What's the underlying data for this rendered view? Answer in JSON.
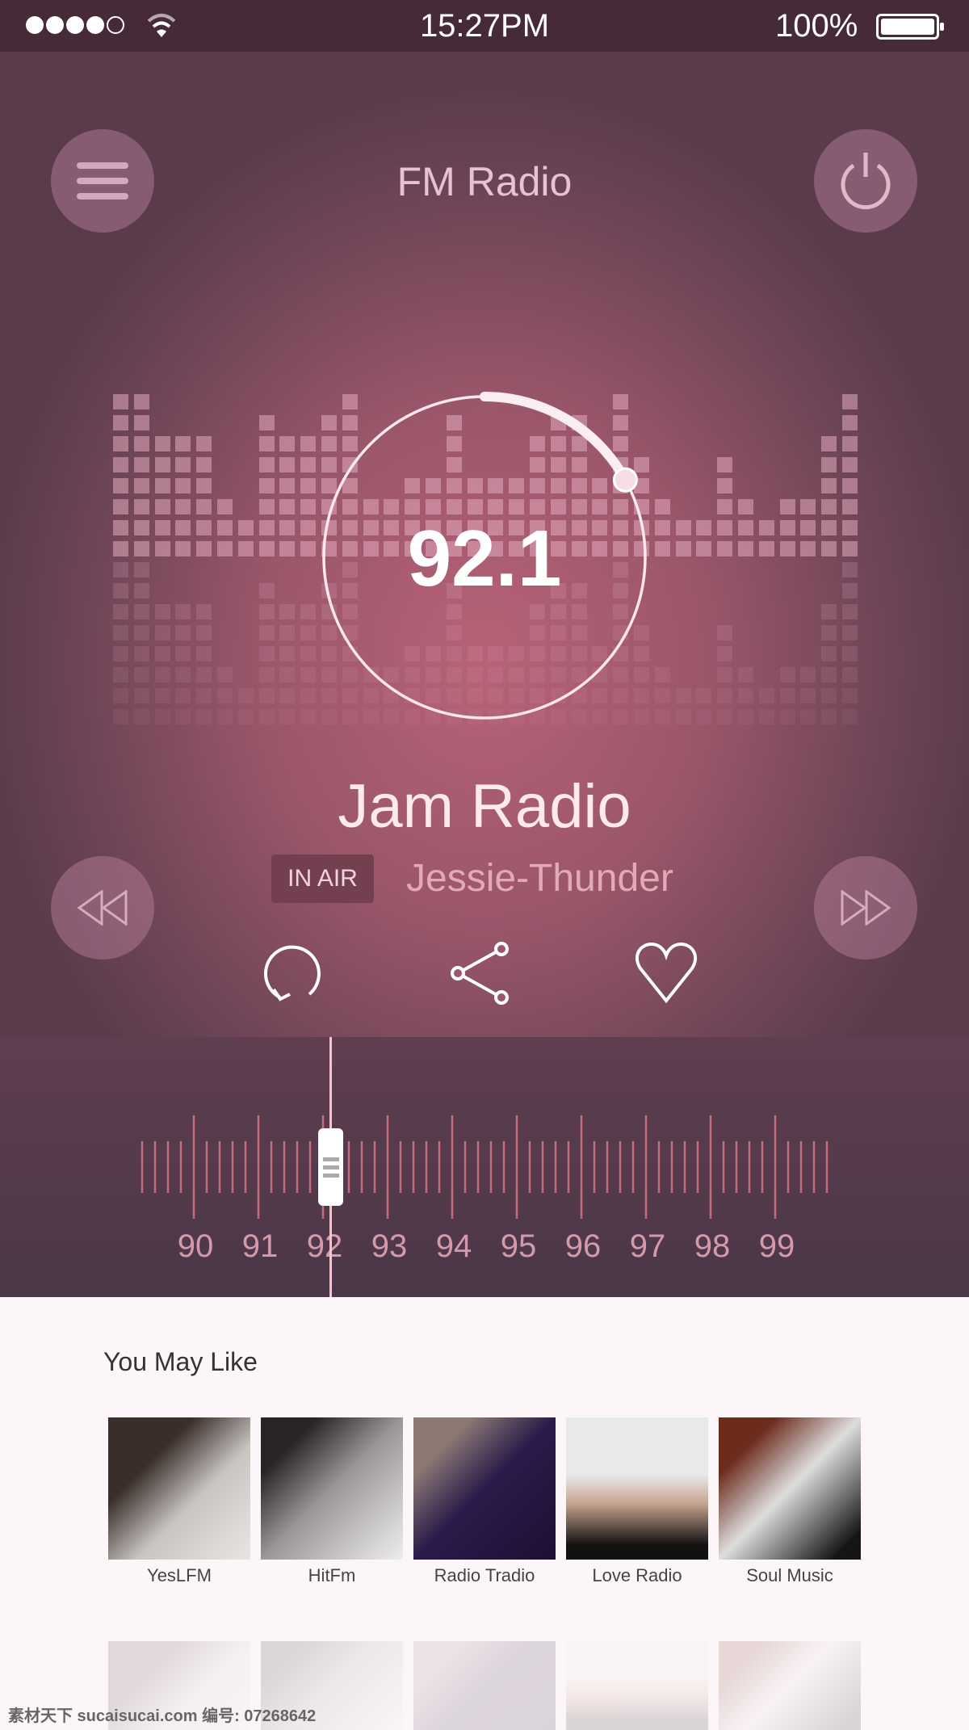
{
  "status_bar": {
    "signal_filled": 4,
    "signal_total": 5,
    "time": "15:27PM",
    "battery": "100%",
    "icons": [
      "signal-dots-icon",
      "wifi-icon",
      "battery-icon"
    ]
  },
  "header": {
    "title": "FM Radio",
    "menu_icon": "menu-icon",
    "power_icon": "power-icon"
  },
  "player": {
    "frequency": "92.1",
    "station": "Jam Radio",
    "badge": "IN AIR",
    "track": "Jessie-Thunder",
    "dial_progress": 0.17,
    "controls": [
      "rewind-icon",
      "fast-forward-icon",
      "repeat-icon",
      "share-icon",
      "heart-icon"
    ]
  },
  "tuner": {
    "labels": [
      "90",
      "91",
      "92",
      "93",
      "94",
      "95",
      "96",
      "97",
      "98",
      "99"
    ],
    "value": 92.1
  },
  "recommend": {
    "title": "You May Like",
    "items": [
      {
        "label": "YesLFM"
      },
      {
        "label": "HitFm"
      },
      {
        "label": "Radio Tradio"
      },
      {
        "label": "Love Radio"
      },
      {
        "label": "Soul Music"
      }
    ]
  },
  "colors": {
    "accent": "#b86277",
    "status_bar": "#472a38",
    "tick": "#c76a7a",
    "badge": "#74404f"
  }
}
